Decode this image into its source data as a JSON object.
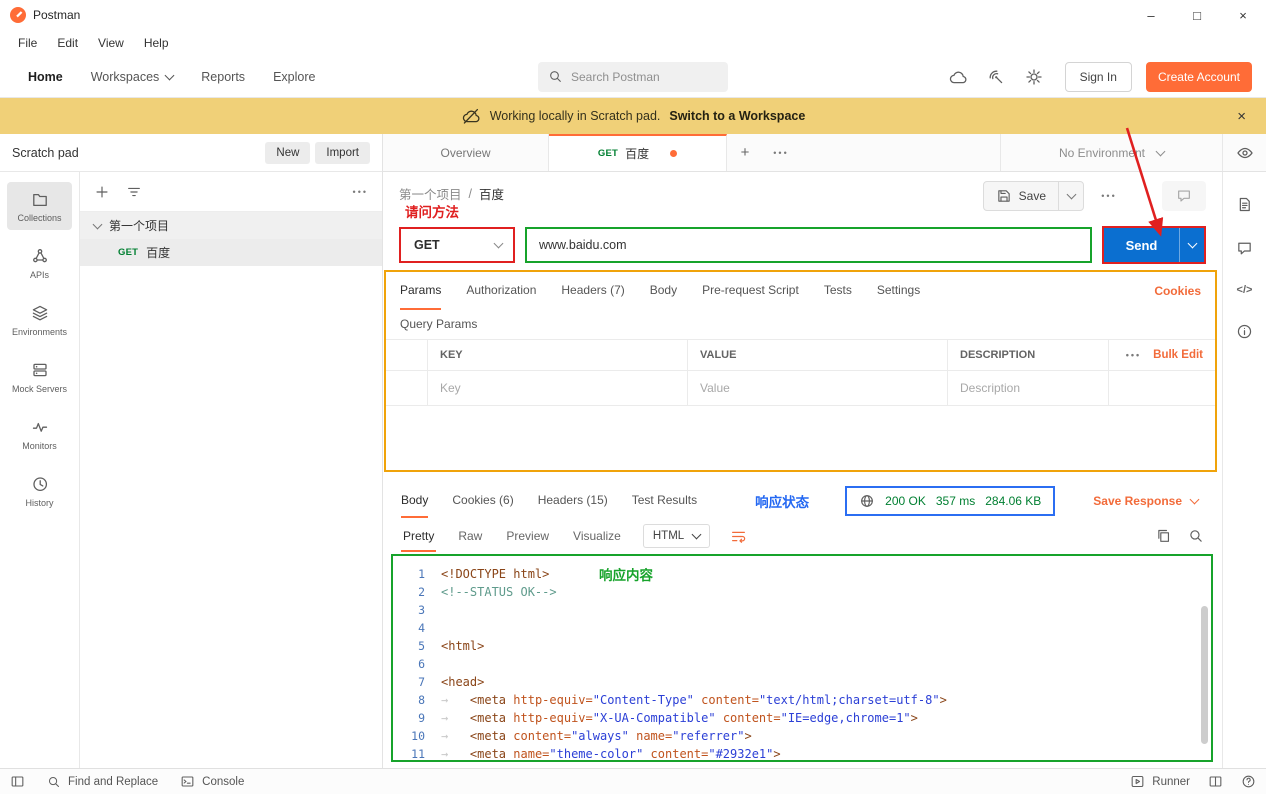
{
  "titlebar": {
    "app": "Postman",
    "minimize": "–",
    "maximize": "□",
    "close": "×"
  },
  "menubar": {
    "items": [
      "File",
      "Edit",
      "View",
      "Help"
    ]
  },
  "topnav": {
    "home": "Home",
    "workspaces": "Workspaces",
    "reports": "Reports",
    "explore": "Explore",
    "search_placeholder": "Search Postman",
    "sign_in": "Sign In",
    "create_account": "Create Account"
  },
  "banner": {
    "text": "Working locally in Scratch pad.",
    "link": "Switch to a Workspace",
    "close": "×"
  },
  "sidebar": {
    "title": "Scratch pad",
    "new": "New",
    "import": "Import",
    "rail": [
      "Collections",
      "APIs",
      "Environments",
      "Mock Servers",
      "Monitors",
      "History"
    ],
    "collection": "第一个项目",
    "request_method": "GET",
    "request_name": "百度"
  },
  "tabbar": {
    "overview": "Overview",
    "method": "GET",
    "name": "百度",
    "environment": "No Environment"
  },
  "request": {
    "crumb_collection": "第一个项目",
    "crumb_sep": "/",
    "crumb_name": "百度",
    "save": "Save",
    "method": "GET",
    "url": "www.baidu.com",
    "send": "Send",
    "tabs": [
      "Params",
      "Authorization",
      "Headers (7)",
      "Body",
      "Pre-request Script",
      "Tests",
      "Settings"
    ],
    "cookies": "Cookies",
    "query_params": "Query Params",
    "columns": {
      "key": "KEY",
      "value": "VALUE",
      "description": "DESCRIPTION"
    },
    "bulk_edit": "Bulk Edit",
    "placeholders": {
      "key": "Key",
      "value": "Value",
      "description": "Description"
    }
  },
  "response": {
    "tabs": [
      "Body",
      "Cookies (6)",
      "Headers (15)",
      "Test Results"
    ],
    "status": "200 OK",
    "time": "357 ms",
    "size": "284.06 KB",
    "save_response": "Save Response",
    "views": [
      "Pretty",
      "Raw",
      "Preview",
      "Visualize"
    ],
    "format": "HTML"
  },
  "annotations": {
    "method_note": "请问方法",
    "status_note": "响应状态",
    "content_note": "响应内容"
  },
  "code": {
    "lines": [
      {
        "n": "1",
        "seg": [
          [
            "t",
            "<!DOCTYPE html>"
          ]
        ]
      },
      {
        "n": "2",
        "seg": [
          [
            "c",
            "<!--STATUS OK-->"
          ]
        ]
      },
      {
        "n": "3",
        "seg": []
      },
      {
        "n": "4",
        "seg": []
      },
      {
        "n": "5",
        "seg": [
          [
            "t",
            "<html>"
          ]
        ]
      },
      {
        "n": "6",
        "seg": []
      },
      {
        "n": "7",
        "seg": [
          [
            "t",
            "<head>"
          ]
        ]
      },
      {
        "n": "8",
        "seg": [
          [
            "w",
            "→   "
          ],
          [
            "t",
            "<meta "
          ],
          [
            "a",
            "http-equiv="
          ],
          [
            "s",
            "\"Content-Type\""
          ],
          [
            "t",
            " "
          ],
          [
            "a",
            "content="
          ],
          [
            "s",
            "\"text/html;charset=utf-8\""
          ],
          [
            "t",
            ">"
          ]
        ]
      },
      {
        "n": "9",
        "seg": [
          [
            "w",
            "→   "
          ],
          [
            "t",
            "<meta "
          ],
          [
            "a",
            "http-equiv="
          ],
          [
            "s",
            "\"X-UA-Compatible\""
          ],
          [
            "t",
            " "
          ],
          [
            "a",
            "content="
          ],
          [
            "s",
            "\"IE=edge,chrome=1\""
          ],
          [
            "t",
            ">"
          ]
        ]
      },
      {
        "n": "10",
        "seg": [
          [
            "w",
            "→   "
          ],
          [
            "t",
            "<meta "
          ],
          [
            "a",
            "content="
          ],
          [
            "s",
            "\"always\""
          ],
          [
            "t",
            " "
          ],
          [
            "a",
            "name="
          ],
          [
            "s",
            "\"referrer\""
          ],
          [
            "t",
            ">"
          ]
        ]
      },
      {
        "n": "11",
        "seg": [
          [
            "w",
            "→   "
          ],
          [
            "t",
            "<meta "
          ],
          [
            "a",
            "name="
          ],
          [
            "s",
            "\"theme-color\""
          ],
          [
            "t",
            " "
          ],
          [
            "a",
            "content="
          ],
          [
            "s",
            "\"#2932e1\""
          ],
          [
            "t",
            ">"
          ]
        ]
      }
    ]
  },
  "statusbar": {
    "find_replace": "Find and Replace",
    "console": "Console",
    "runner": "Runner"
  },
  "glyphs": {
    "plus": "+",
    "more": "•••",
    "code_icon": "</>"
  },
  "colors": {
    "brand_orange": "#ff6c37",
    "send_blue": "#0b6fd0",
    "annotation_red": "#e02020",
    "annotation_green": "#17a32b",
    "annotation_blue": "#2468f2",
    "annotation_amber": "#f0a30a",
    "status_green": "#007f31",
    "banner_yellow": "#f0d078"
  }
}
